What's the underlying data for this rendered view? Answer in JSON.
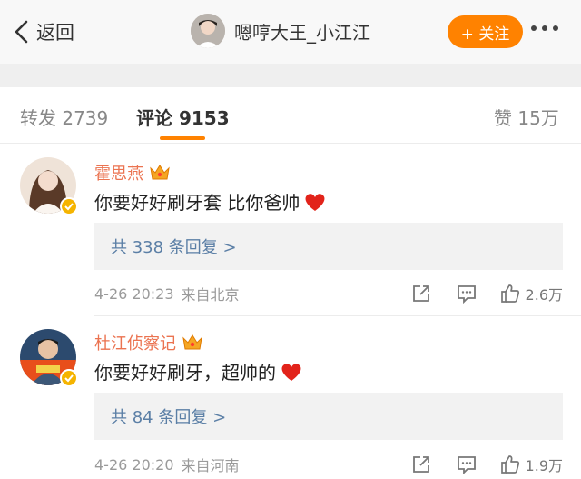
{
  "header": {
    "back_label": "返回",
    "title": "嗯哼大王_小江江",
    "follow_label": "+ 关注",
    "back_icon": "chevron-left-icon",
    "more_icon": "more-dots-icon"
  },
  "tabs": [
    {
      "label": "转发 2739",
      "active": false
    },
    {
      "label": "评论 9153",
      "active": true
    },
    {
      "label": "赞 15万",
      "active": false
    }
  ],
  "colors": {
    "accent": "#ff8200",
    "name": "#eb7350",
    "reply_link": "#5b7fa6",
    "verified_badge": "#f5b400",
    "heart": "#e2231a"
  },
  "comments": [
    {
      "name": "霍思燕",
      "text": "你要好好刷牙套 比你爸帅",
      "reply_link": "共 338 条回复 >",
      "time": "4-26 20:23",
      "location": "来自北京",
      "likes": "2.6万"
    },
    {
      "name": "杜江侦察记",
      "text": "你要好好刷牙，超帅的",
      "reply_link": "共 84 条回复 >",
      "time": "4-26 20:20",
      "location": "来自河南",
      "likes": "1.9万"
    }
  ]
}
